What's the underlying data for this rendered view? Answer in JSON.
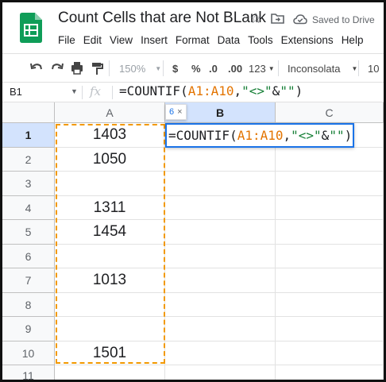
{
  "app": {
    "title": "Count Cells that are Not BLank",
    "save_status": "Saved to Drive",
    "colors": {
      "sheets_green": "#0f9d58",
      "selection_blue": "#1a73e8",
      "range_orange": "#f29900"
    }
  },
  "menu": [
    "File",
    "Edit",
    "View",
    "Insert",
    "Format",
    "Data",
    "Tools",
    "Extensions",
    "Help"
  ],
  "toolbar": {
    "undo_icon": "undo-icon",
    "redo_icon": "redo-icon",
    "print_icon": "print-icon",
    "paint_format_icon": "paint-format-icon",
    "zoom": "150%",
    "currency": "$",
    "percent": "%",
    "decrease_decimal": ".0",
    "increase_decimal": ".00",
    "more_formats": "123",
    "font": "Inconsolata",
    "font_size": "10"
  },
  "formula_bar": {
    "cell_ref": "B1",
    "fx": "fx",
    "parts": {
      "func": "=COUNTIF(",
      "ref": "A1:A10",
      "sep": ",",
      "str1": "\"<>\"",
      "amp": "&",
      "str2": "\"\"",
      "close": ")"
    }
  },
  "sheet": {
    "columns": [
      "A",
      "B",
      "C"
    ],
    "rows": [
      {
        "num": "1",
        "a": "1403"
      },
      {
        "num": "2",
        "a": "1050"
      },
      {
        "num": "3",
        "a": ""
      },
      {
        "num": "4",
        "a": "1311"
      },
      {
        "num": "5",
        "a": "1454"
      },
      {
        "num": "6",
        "a": ""
      },
      {
        "num": "7",
        "a": "1013"
      },
      {
        "num": "8",
        "a": ""
      },
      {
        "num": "9",
        "a": ""
      },
      {
        "num": "10",
        "a": "1501"
      },
      {
        "num": "11",
        "a": ""
      }
    ],
    "result_tooltip": {
      "value": "6",
      "close": "×"
    }
  }
}
